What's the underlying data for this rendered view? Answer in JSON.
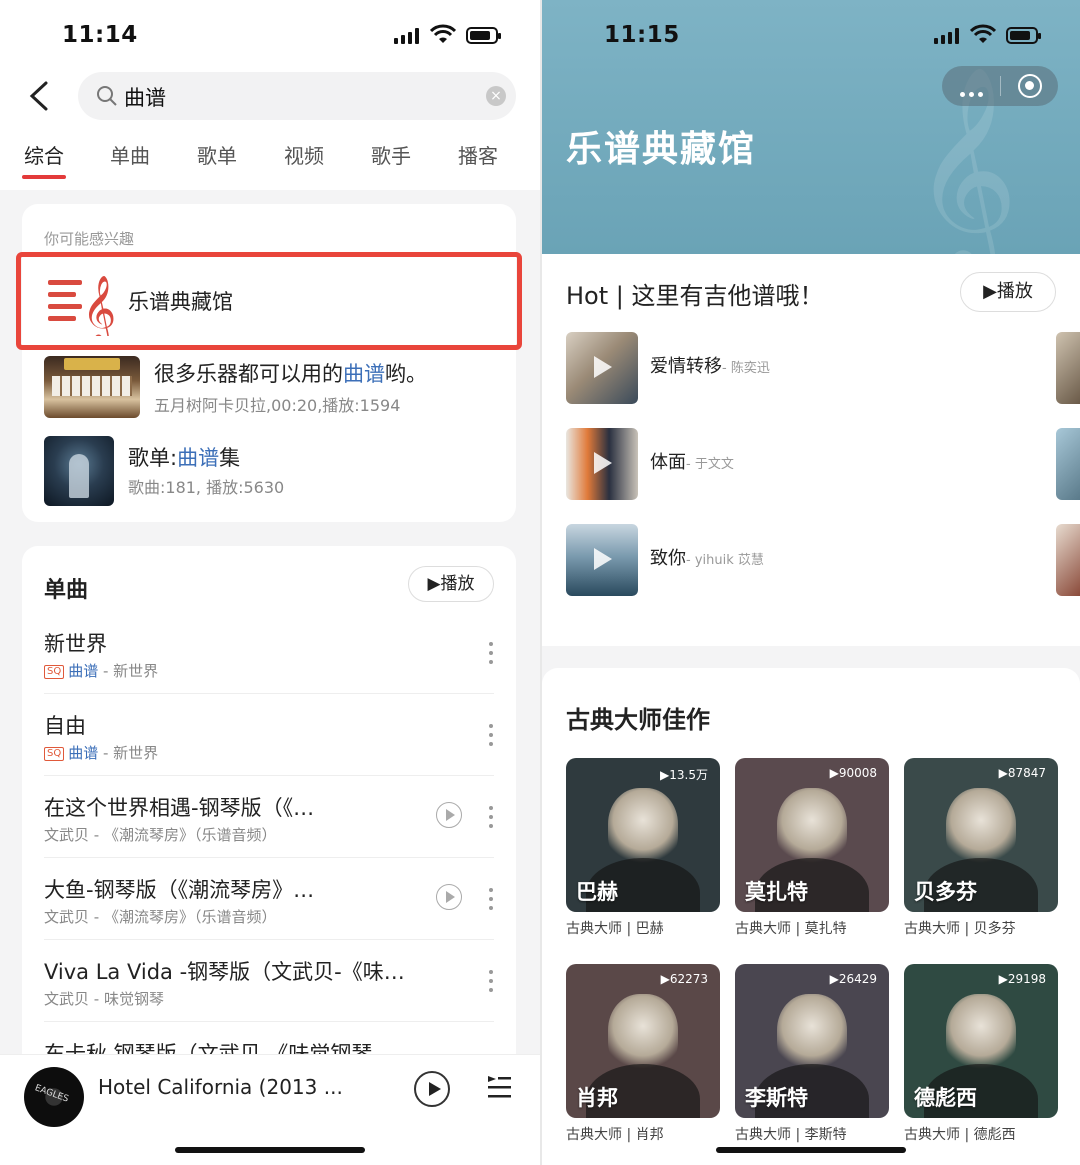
{
  "left": {
    "status": {
      "time": "11:14"
    },
    "search": {
      "query": "曲谱",
      "clear": "×"
    },
    "tabs": [
      "综合",
      "单曲",
      "歌单",
      "视频",
      "歌手",
      "播客"
    ],
    "suggest": {
      "hint": "你可能感兴趣",
      "highlight_title": "乐谱典藏馆",
      "video": {
        "pre": "很多乐器都可以用的",
        "key": "曲谱",
        "post": "哟。",
        "meta": "五月树阿卡贝拉,00:20,播放:1594"
      },
      "playlist": {
        "pre": "歌单:",
        "key": "曲谱",
        "post": "集",
        "meta": "歌曲:181, 播放:5630"
      }
    },
    "songs": {
      "title": "单曲",
      "play_label": "▶播放",
      "items": [
        {
          "name": "新世界",
          "sq": "SQ",
          "artist": "曲谱",
          "meta": " - 新世界"
        },
        {
          "name": "自由",
          "sq": "SQ",
          "artist": "曲谱",
          "meta": " - 新世界"
        },
        {
          "name": "在这个世界相遇-钢琴版（《…",
          "meta": "文武贝 - 《潮流琴房》（乐谱音频）"
        },
        {
          "name": "大鱼-钢琴版（《潮流琴房》…",
          "meta": "文武贝 - 《潮流琴房》（乐谱音频）"
        },
        {
          "name": "Viva La Vida -钢琴版（文武贝-《味…",
          "meta": "文武贝 - 味觉钢琴"
        },
        {
          "name": "东卡秋 钢琴版（文武贝 《味觉钢琴",
          "meta": ""
        }
      ]
    },
    "player": {
      "title": "Hotel California (2013 ...",
      "disc_label": "EAGLES"
    }
  },
  "right": {
    "status": {
      "time": "11:15"
    },
    "header": {
      "title": "乐谱典藏馆",
      "clef": "𝄞",
      "accent": "#6aa3b6"
    },
    "hot": {
      "title": "Hot | 这里有吉他谱哦！",
      "play_label": "▶播放",
      "items": [
        {
          "name": "爱情转移",
          "artist": "- 陈奕迅"
        },
        {
          "name": "体面",
          "artist": "- 于文文"
        },
        {
          "name": "致你",
          "artist": "- yihuik 苡慧"
        }
      ]
    },
    "classics": {
      "title": "古典大师佳作",
      "items": [
        {
          "name": "巴赫",
          "count": "▶13.5万",
          "caption": "古典大师 | 巴赫",
          "bg": "#2f3a3e"
        },
        {
          "name": "莫扎特",
          "count": "▶90008",
          "caption": "古典大师 | 莫扎特",
          "bg": "#5a4a4e"
        },
        {
          "name": "贝多芬",
          "count": "▶87847",
          "caption": "古典大师 | 贝多芬",
          "bg": "#3a4a4a"
        },
        {
          "name": "肖邦",
          "count": "▶62273",
          "caption": "古典大师 | 肖邦",
          "bg": "#5a4848"
        },
        {
          "name": "李斯特",
          "count": "▶26429",
          "caption": "古典大师 | 李斯特",
          "bg": "#4a4650"
        },
        {
          "name": "德彪西",
          "count": "▶29198",
          "caption": "古典大师 | 德彪西",
          "bg": "#2f4a42"
        }
      ]
    }
  }
}
